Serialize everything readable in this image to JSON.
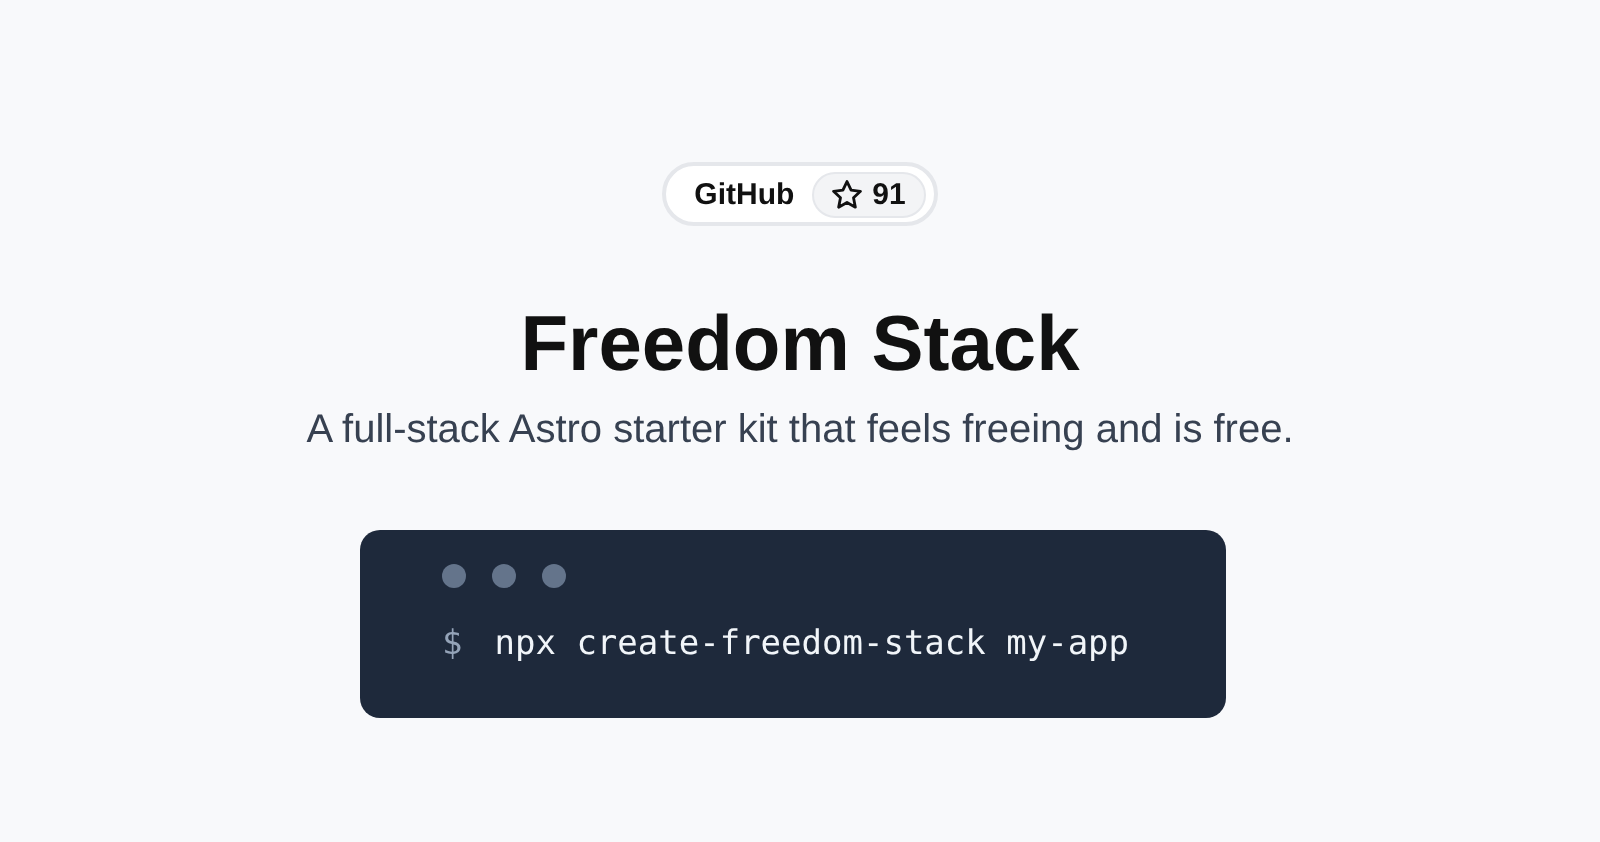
{
  "repo_badge": {
    "label": "GitHub",
    "stars": "91"
  },
  "title": "Freedom Stack",
  "subtitle": "A full-stack Astro starter kit that feels freeing and is free.",
  "terminal": {
    "prompt": "$",
    "command": "npx create-freedom-stack my-app"
  }
}
